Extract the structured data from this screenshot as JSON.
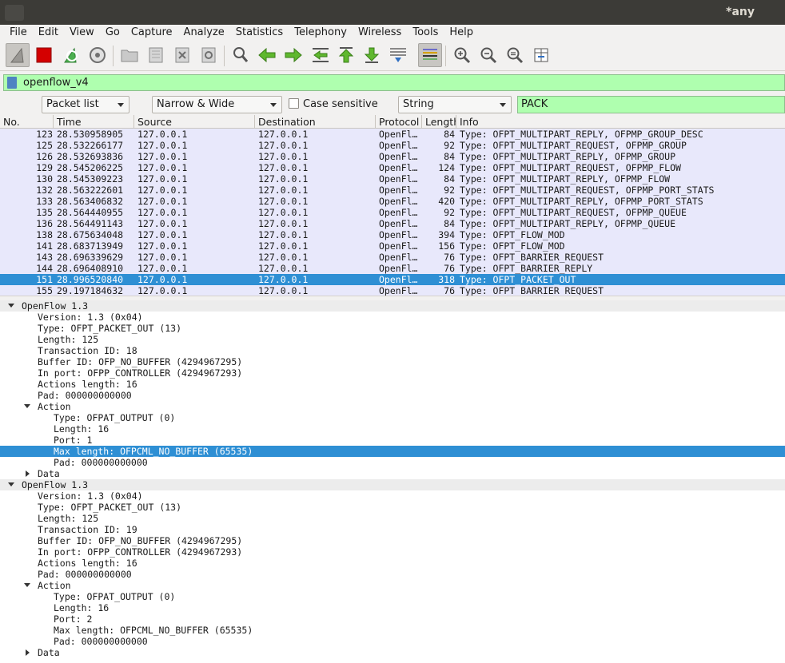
{
  "window": {
    "title": "*any"
  },
  "menu": [
    "File",
    "Edit",
    "View",
    "Go",
    "Capture",
    "Analyze",
    "Statistics",
    "Telephony",
    "Wireless",
    "Tools",
    "Help"
  ],
  "toolbar_icons": [
    "shark-fin-icon",
    "stop-icon",
    "restart-icon",
    "options-gear-icon",
    "open-folder-icon",
    "save-file-icon",
    "close-file-icon",
    "reload-icon",
    "find-icon",
    "back-arrow-icon",
    "forward-arrow-icon",
    "go-to-packet-icon",
    "first-packet-icon",
    "last-packet-icon",
    "autoscroll-icon",
    "colorize-icon",
    "zoom-in-icon",
    "zoom-out-icon",
    "zoom-normal-icon",
    "resize-columns-icon"
  ],
  "filter": {
    "value": "openflow_v4"
  },
  "find": {
    "search_in": "Packet list",
    "char_width": "Narrow & Wide",
    "case_sensitive_label": "Case sensitive",
    "search_type": "String",
    "search_value": "PACK"
  },
  "columns": [
    "No.",
    "Time",
    "Source",
    "Destination",
    "Protocol",
    "Length",
    "Info"
  ],
  "packets": [
    {
      "no": "123",
      "time": "28.530958905",
      "src": "127.0.0.1",
      "dst": "127.0.0.1",
      "proto": "OpenFl…",
      "len": "84",
      "info": "Type: OFPT_MULTIPART_REPLY, OFPMP_GROUP_DESC"
    },
    {
      "no": "125",
      "time": "28.532266177",
      "src": "127.0.0.1",
      "dst": "127.0.0.1",
      "proto": "OpenFl…",
      "len": "92",
      "info": "Type: OFPT_MULTIPART_REQUEST, OFPMP_GROUP"
    },
    {
      "no": "126",
      "time": "28.532693836",
      "src": "127.0.0.1",
      "dst": "127.0.0.1",
      "proto": "OpenFl…",
      "len": "84",
      "info": "Type: OFPT_MULTIPART_REPLY, OFPMP_GROUP"
    },
    {
      "no": "129",
      "time": "28.545206225",
      "src": "127.0.0.1",
      "dst": "127.0.0.1",
      "proto": "OpenFl…",
      "len": "124",
      "info": "Type: OFPT_MULTIPART_REQUEST, OFPMP_FLOW"
    },
    {
      "no": "130",
      "time": "28.545309223",
      "src": "127.0.0.1",
      "dst": "127.0.0.1",
      "proto": "OpenFl…",
      "len": "84",
      "info": "Type: OFPT_MULTIPART_REPLY, OFPMP_FLOW"
    },
    {
      "no": "132",
      "time": "28.563222601",
      "src": "127.0.0.1",
      "dst": "127.0.0.1",
      "proto": "OpenFl…",
      "len": "92",
      "info": "Type: OFPT_MULTIPART_REQUEST, OFPMP_PORT_STATS"
    },
    {
      "no": "133",
      "time": "28.563406832",
      "src": "127.0.0.1",
      "dst": "127.0.0.1",
      "proto": "OpenFl…",
      "len": "420",
      "info": "Type: OFPT_MULTIPART_REPLY, OFPMP_PORT_STATS"
    },
    {
      "no": "135",
      "time": "28.564440955",
      "src": "127.0.0.1",
      "dst": "127.0.0.1",
      "proto": "OpenFl…",
      "len": "92",
      "info": "Type: OFPT_MULTIPART_REQUEST, OFPMP_QUEUE"
    },
    {
      "no": "136",
      "time": "28.564491143",
      "src": "127.0.0.1",
      "dst": "127.0.0.1",
      "proto": "OpenFl…",
      "len": "84",
      "info": "Type: OFPT_MULTIPART_REPLY, OFPMP_QUEUE"
    },
    {
      "no": "138",
      "time": "28.675634048",
      "src": "127.0.0.1",
      "dst": "127.0.0.1",
      "proto": "OpenFl…",
      "len": "394",
      "info": "Type: OFPT_FLOW_MOD"
    },
    {
      "no": "141",
      "time": "28.683713949",
      "src": "127.0.0.1",
      "dst": "127.0.0.1",
      "proto": "OpenFl…",
      "len": "156",
      "info": "Type: OFPT_FLOW_MOD"
    },
    {
      "no": "143",
      "time": "28.696339629",
      "src": "127.0.0.1",
      "dst": "127.0.0.1",
      "proto": "OpenFl…",
      "len": "76",
      "info": "Type: OFPT_BARRIER_REQUEST"
    },
    {
      "no": "144",
      "time": "28.696408910",
      "src": "127.0.0.1",
      "dst": "127.0.0.1",
      "proto": "OpenFl…",
      "len": "76",
      "info": "Type: OFPT_BARRIER_REPLY"
    },
    {
      "no": "151",
      "time": "28.996520840",
      "src": "127.0.0.1",
      "dst": "127.0.0.1",
      "proto": "OpenFl…",
      "len": "318",
      "info": "Type: OFPT_PACKET_OUT",
      "selected": true
    },
    {
      "no": "155",
      "time": "29.197184632",
      "src": "127.0.0.1",
      "dst": "127.0.0.1",
      "proto": "OpenFl…",
      "len": "76",
      "info": "Type: OFPT_BARRIER_REQUEST"
    }
  ],
  "details": [
    {
      "text": "OpenFlow 1.3",
      "level": 0,
      "toggle": "expanded",
      "header": true
    },
    {
      "text": "Version: 1.3 (0x04)",
      "level": 1
    },
    {
      "text": "Type: OFPT_PACKET_OUT (13)",
      "level": 1
    },
    {
      "text": "Length: 125",
      "level": 1
    },
    {
      "text": "Transaction ID: 18",
      "level": 1
    },
    {
      "text": "Buffer ID: OFP_NO_BUFFER (4294967295)",
      "level": 1
    },
    {
      "text": "In port: OFPP_CONTROLLER (4294967293)",
      "level": 1
    },
    {
      "text": "Actions length: 16",
      "level": 1
    },
    {
      "text": "Pad: 000000000000",
      "level": 1
    },
    {
      "text": "Action",
      "level": 1,
      "toggle": "expanded"
    },
    {
      "text": "Type: OFPAT_OUTPUT (0)",
      "level": 2
    },
    {
      "text": "Length: 16",
      "level": 2
    },
    {
      "text": "Port: 1",
      "level": 2
    },
    {
      "text": "Max length: OFPCML_NO_BUFFER (65535)",
      "level": 2,
      "selected": true
    },
    {
      "text": "Pad: 000000000000",
      "level": 2
    },
    {
      "text": "Data",
      "level": 1,
      "toggle": "collapsed"
    },
    {
      "text": "OpenFlow 1.3",
      "level": 0,
      "toggle": "expanded",
      "header": true
    },
    {
      "text": "Version: 1.3 (0x04)",
      "level": 1
    },
    {
      "text": "Type: OFPT_PACKET_OUT (13)",
      "level": 1
    },
    {
      "text": "Length: 125",
      "level": 1
    },
    {
      "text": "Transaction ID: 19",
      "level": 1
    },
    {
      "text": "Buffer ID: OFP_NO_BUFFER (4294967295)",
      "level": 1
    },
    {
      "text": "In port: OFPP_CONTROLLER (4294967293)",
      "level": 1
    },
    {
      "text": "Actions length: 16",
      "level": 1
    },
    {
      "text": "Pad: 000000000000",
      "level": 1
    },
    {
      "text": "Action",
      "level": 1,
      "toggle": "expanded"
    },
    {
      "text": "Type: OFPAT_OUTPUT (0)",
      "level": 2
    },
    {
      "text": "Length: 16",
      "level": 2
    },
    {
      "text": "Port: 2",
      "level": 2
    },
    {
      "text": "Max length: OFPCML_NO_BUFFER (65535)",
      "level": 2
    },
    {
      "text": "Pad: 000000000000",
      "level": 2
    },
    {
      "text": "Data",
      "level": 1,
      "toggle": "collapsed"
    }
  ],
  "colors": {
    "selection": "#2e8fd4",
    "filter_ok": "#afffaf",
    "packet_row": "#e8e8fb",
    "titlebar": "#3c3b37"
  }
}
